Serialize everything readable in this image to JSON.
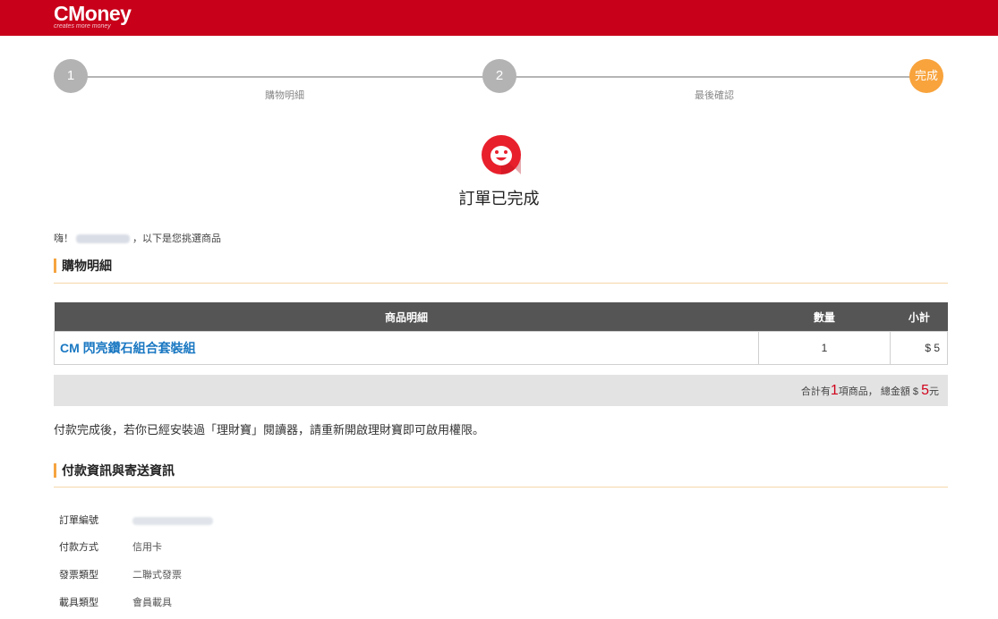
{
  "header": {
    "logo_main": "CMoney",
    "logo_sub": "creates more money"
  },
  "steps": [
    {
      "number": "1",
      "label": "購物明細"
    },
    {
      "number": "2",
      "label": "最後確認"
    },
    {
      "number": "完成"
    }
  ],
  "result": {
    "title": "訂單已完成"
  },
  "greeting": {
    "prefix": "嗨！",
    "suffix": "，以下是您挑選商品"
  },
  "cart_section": {
    "title": "購物明細"
  },
  "table": {
    "headers": {
      "name": "商品明細",
      "qty": "數量",
      "subtotal": "小計"
    },
    "rows": [
      {
        "name": "CM 閃亮鑽石組合套裝組",
        "qty": "1",
        "subtotal": "$ 5"
      }
    ]
  },
  "summary": {
    "prefix": "合計有",
    "count": "1",
    "mid": "項商品， 總金額 $ ",
    "amount": "5",
    "unit": "元"
  },
  "note": "付款完成後，若你已經安裝過「理財寶」閱讀器，請重新開啟理財寶即可啟用權限。",
  "info_section": {
    "title": "付款資訊與寄送資訊",
    "rows": [
      {
        "label": "訂單編號",
        "value": ""
      },
      {
        "label": "付款方式",
        "value": "信用卡"
      },
      {
        "label": "發票類型",
        "value": "二聯式發票"
      },
      {
        "label": "載具類型",
        "value": "會員載具"
      }
    ]
  },
  "colors": {
    "brand_red": "#c8001a",
    "accent_orange": "#f8a33c",
    "link_blue": "#1a78c2"
  }
}
